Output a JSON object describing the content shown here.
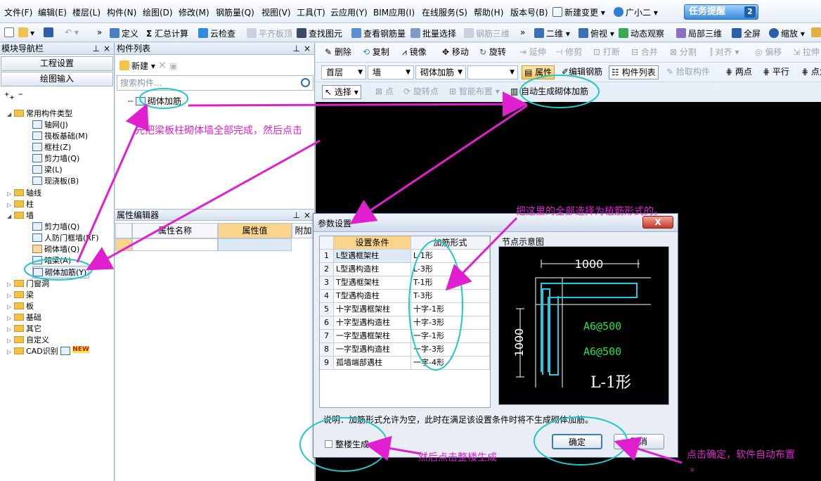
{
  "menubar": {
    "items": [
      "文件(F)",
      "编辑(E)",
      "楼层(L)",
      "构件(N)",
      "绘图(D)",
      "修改(M)",
      "钢筋量(Q)",
      "视图(V)",
      "工具(T)",
      "云应用(Y)",
      "BIM应用(I)",
      "在线服务(S)",
      "帮助(H)",
      "版本号(B)"
    ],
    "new_change": "新建变更",
    "assistant": "广小二",
    "task_label": "任务提醒",
    "task_count": "2"
  },
  "toolbar1": {
    "define": "定义",
    "sum": "汇总计算",
    "cloud_check": "云检查",
    "flat_board": "平齐板顶",
    "find": "查找图元",
    "view_qty": "查看钢筋量",
    "batch_select": "批量选择",
    "rebar_3d": "钢筋三维",
    "two_d": "二维",
    "top_view": "俯视",
    "dynamic": "动态观察",
    "local_3d": "局部三维",
    "fullscreen": "全屏",
    "zoom": "缩放"
  },
  "left_panel": {
    "title": "模块导航栏",
    "project_settings": "工程设置",
    "drawing_input": "绘图输入",
    "tree": {
      "common": "常用构件类型",
      "common_children": [
        "轴网(J)",
        "筏板基础(M)",
        "框柱(Z)",
        "剪力墙(Q)",
        "梁(L)",
        "现浇板(B)"
      ],
      "axis": "轴线",
      "column": "柱",
      "wall": "墙",
      "wall_children": [
        "剪力墙(Q)",
        "人防门框墙(RF)",
        "砌体墙(Q)",
        "暗梁(A)",
        "砌体加筋(Y)"
      ],
      "rest": [
        "门窗洞",
        "梁",
        "板",
        "基础",
        "其它",
        "自定义",
        "CAD识别"
      ],
      "new_badge": "NEW"
    }
  },
  "mid_panel": {
    "title": "构件列表",
    "new_label": "新建",
    "search_placeholder": "搜索构件...",
    "component": "砌体加筋",
    "prop_title": "属性编辑器",
    "prop_headers": [
      "属性名称",
      "属性值",
      "附加"
    ]
  },
  "right_toolbar": {
    "row1": [
      "删除",
      "复制",
      "镜像",
      "移动",
      "旋转",
      "延伸",
      "修剪",
      "打断",
      "合并",
      "分割",
      "对齐",
      "偏移",
      "拉伸"
    ],
    "floor": "首层",
    "category": "墙",
    "type": "砌体加筋",
    "property": "属性",
    "edit_rebar": "编辑钢筋",
    "comp_list": "构件列表",
    "pick": "拾取构件",
    "two_points": "两点",
    "parallel": "平行",
    "point_angle": "点角",
    "select": "选择",
    "point": "点",
    "rotate_point": "旋转点",
    "smart_layout": "智能布置",
    "auto_gen": "自动生成砌体加筋"
  },
  "dialog": {
    "title": "参数设置",
    "close": "X",
    "headers": [
      "设置条件",
      "加筋形式"
    ],
    "rows": [
      {
        "n": "1",
        "cond": "L型遇框架柱",
        "form": "L-1形"
      },
      {
        "n": "2",
        "cond": "L型遇构造柱",
        "form": "L-3形"
      },
      {
        "n": "3",
        "cond": "T型遇框架柱",
        "form": "T-1形"
      },
      {
        "n": "4",
        "cond": "T型遇构造柱",
        "form": "T-3形"
      },
      {
        "n": "5",
        "cond": "十字型遇框架柱",
        "form": "十字-1形"
      },
      {
        "n": "6",
        "cond": "十字型遇构造柱",
        "form": "十字-3形"
      },
      {
        "n": "7",
        "cond": "一字型遇框架柱",
        "form": "一字-1形"
      },
      {
        "n": "8",
        "cond": "一字型遇构造柱",
        "form": "一字-3形"
      },
      {
        "n": "9",
        "cond": "孤墙端部遇柱",
        "form": "一字-4形"
      }
    ],
    "node_label": "节点示意图",
    "diagram": {
      "dim_h": "1000",
      "dim_v": "1000",
      "rebar1": "A6@500",
      "rebar2": "A6@500",
      "shape": "L-1形"
    },
    "note": "说明：加筋形式允许为空，此时在满足该设置条件时将不生成砌体加筋。",
    "whole_building": "整楼生成",
    "ok": "确定",
    "cancel": "取消"
  },
  "annotations": {
    "a1": "先把梁板柱砌体墙全部完成，然后点击",
    "a2": "把这里的全部选择为植筋形式的。",
    "a3": "然后点击整楼生成",
    "a4": "点击确定，软件自动布置",
    "a4_tail": "。"
  },
  "colors": {
    "annotation": "#e020d0",
    "highlight": "#1ec8c8",
    "rebar": "#27c8e6",
    "dim_text": "#ffffff",
    "rebar_text": "#22e04a"
  }
}
